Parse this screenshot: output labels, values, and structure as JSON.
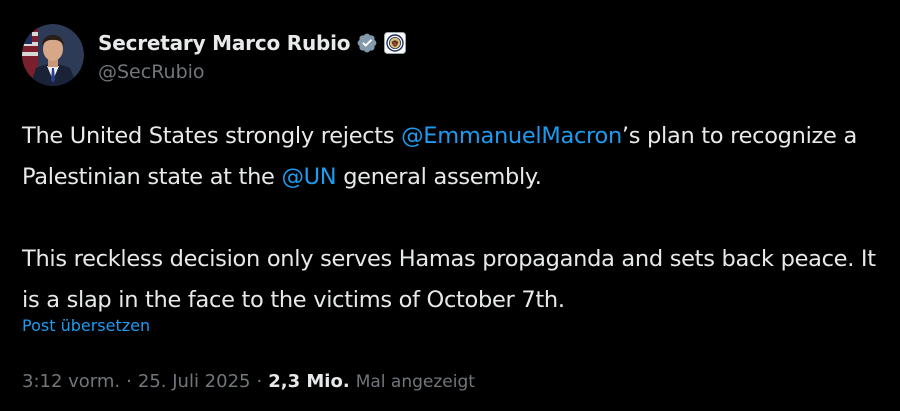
{
  "author": {
    "display_name": "Secretary Marco Rubio",
    "handle": "@SecRubio",
    "verified_badge_icon": "verified-checkmark-icon",
    "affiliation_icon": "state-department-seal-icon"
  },
  "tweet": {
    "para1": {
      "t1": "The United States strongly rejects ",
      "mention1": "@EmmanuelMacron",
      "t2": "’s plan to recognize a Palestinian state at the ",
      "mention2": "@UN",
      "t3": " general assembly."
    },
    "para2": "This reckless decision only serves Hamas propaganda and sets back peace. It is a slap in the face to the victims of October 7th.",
    "translate_link": "Post übersetzen"
  },
  "meta": {
    "time": "3:12 vorm.",
    "separator": "·",
    "date": "25. Juli 2025",
    "views_count": "2,3 Mio.",
    "views_label": "Mal angezeigt"
  },
  "colors": {
    "background": "#000000",
    "text": "#e7e9ea",
    "secondary": "#71767b",
    "link": "#1d9bf0"
  }
}
